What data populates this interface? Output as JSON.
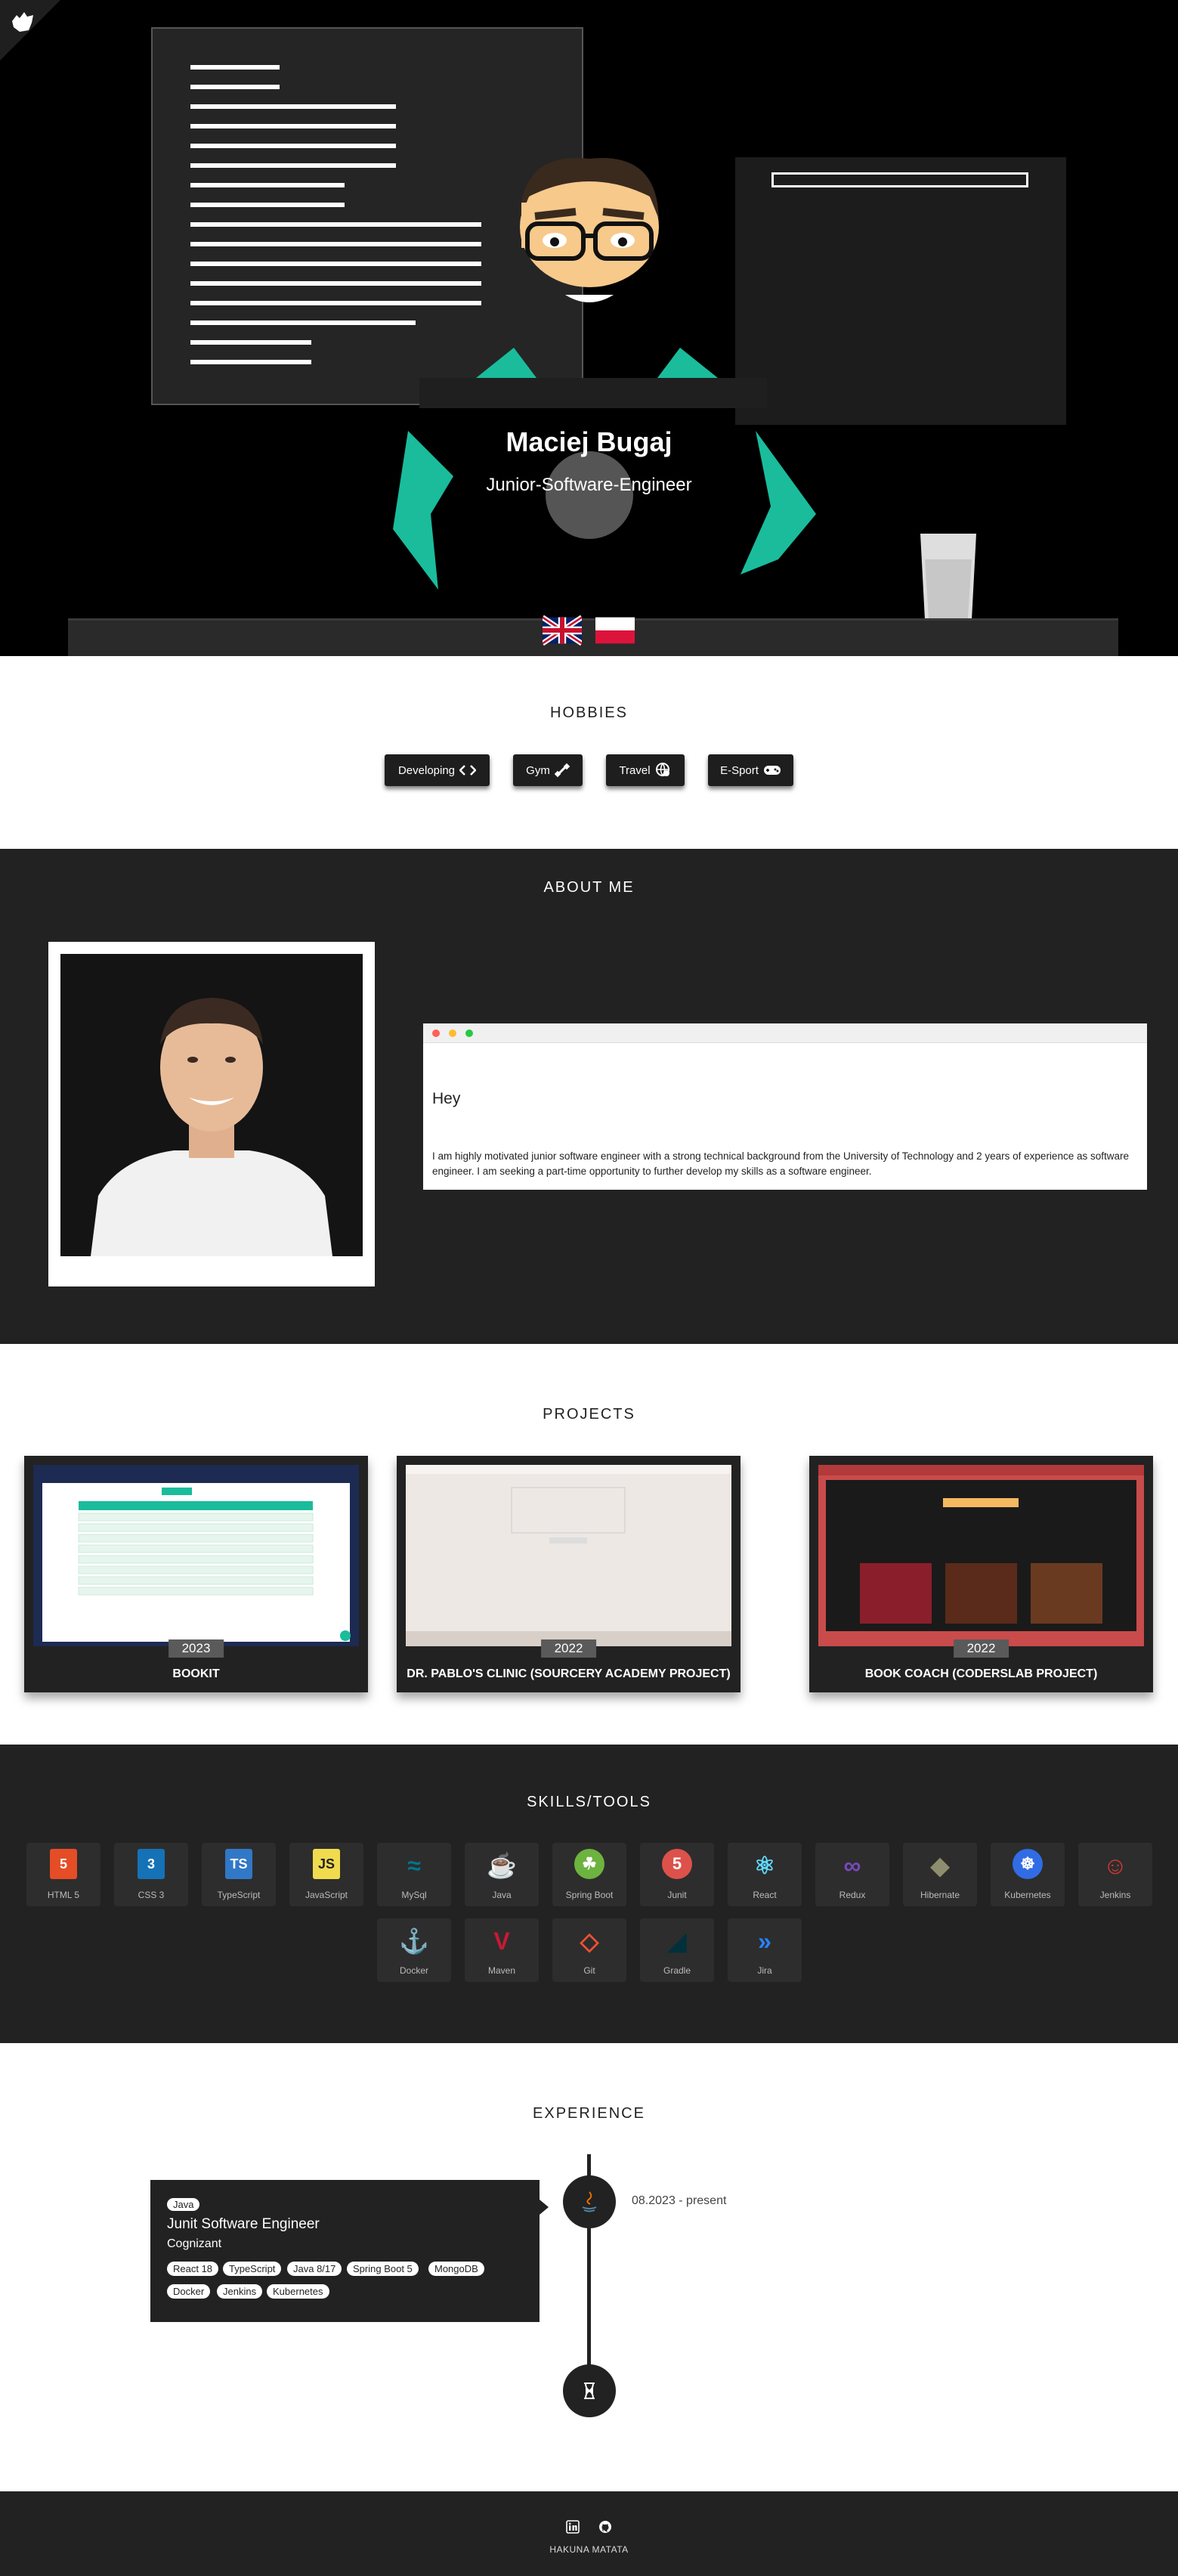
{
  "hero": {
    "name": "Maciej Bugaj",
    "role": "Junior-Software-Engineer",
    "languages": [
      "english-flag",
      "polish-flag"
    ]
  },
  "hobbies": {
    "title": "HOBBIES",
    "items": [
      {
        "label": "Developing",
        "icon": "code-icon"
      },
      {
        "label": "Gym",
        "icon": "dumbbell-icon"
      },
      {
        "label": "Travel",
        "icon": "globe-icon"
      },
      {
        "label": "E-Sport",
        "icon": "gamepad-icon"
      }
    ]
  },
  "about": {
    "title": "ABOUT ME",
    "greeting": "Hey",
    "text": "I am highly motivated junior software engineer with a strong technical background from the University of Technology and 2 years of experience as software engineer. I am seeking a part-time opportunity to further develop my skills as a software engineer."
  },
  "projects": {
    "title": "PROJECTS",
    "items": [
      {
        "year": "2023",
        "title": "BOOKIT"
      },
      {
        "year": "2022",
        "title": "DR. PABLO'S CLINIC (SOURCERY ACADEMY PROJECT)"
      },
      {
        "year": "2022",
        "title": "BOOK COACH (CODERSLAB PROJECT)"
      }
    ]
  },
  "skills": {
    "title": "SKILLS/TOOLS",
    "items": [
      {
        "label": "HTML 5",
        "icon": "html5-icon",
        "color": "#e44d26"
      },
      {
        "label": "CSS 3",
        "icon": "css3-icon",
        "color": "#1572b6"
      },
      {
        "label": "TypeScript",
        "icon": "typescript-icon",
        "color": "#3178c6"
      },
      {
        "label": "JavaScript",
        "icon": "javascript-icon",
        "color": "#f0db4f"
      },
      {
        "label": "MySql",
        "icon": "mysql-icon",
        "color": "#00758f"
      },
      {
        "label": "Java",
        "icon": "java-icon",
        "color": "#e76f00"
      },
      {
        "label": "Spring Boot",
        "icon": "spring-icon",
        "color": "#6db33f"
      },
      {
        "label": "Junit",
        "icon": "junit-icon",
        "color": "#dc524a"
      },
      {
        "label": "React",
        "icon": "react-icon",
        "color": "#61dafb"
      },
      {
        "label": "Redux",
        "icon": "redux-icon",
        "color": "#764abc"
      },
      {
        "label": "Hibernate",
        "icon": "hibernate-icon",
        "color": "#8e8e6e"
      },
      {
        "label": "Kubernetes",
        "icon": "kubernetes-icon",
        "color": "#326ce5"
      },
      {
        "label": "Jenkins",
        "icon": "jenkins-icon",
        "color": "#d33833"
      },
      {
        "label": "Docker",
        "icon": "docker-icon",
        "color": "#2496ed"
      },
      {
        "label": "Maven",
        "icon": "maven-icon",
        "color": "#c71a36"
      },
      {
        "label": "Git",
        "icon": "git-icon",
        "color": "#f05032"
      },
      {
        "label": "Gradle",
        "icon": "gradle-icon",
        "color": "#02303a"
      },
      {
        "label": "Jira",
        "icon": "jira-icon",
        "color": "#2684ff"
      }
    ]
  },
  "experience": {
    "title": "EXPERIENCE",
    "jobs": [
      {
        "tag": "Java",
        "title": "Junit Software Engineer",
        "company": "Cognizant",
        "date": "08.2023 - present",
        "technologies": [
          "React 18",
          "TypeScript",
          "Java 8/17",
          "Spring Boot 5",
          "MongoDB",
          "Docker",
          "Jenkins",
          "Kubernetes"
        ]
      }
    ]
  },
  "footer": {
    "text": "HAKUNA MATATA",
    "icons": [
      "linkedin-icon",
      "github-icon"
    ]
  }
}
